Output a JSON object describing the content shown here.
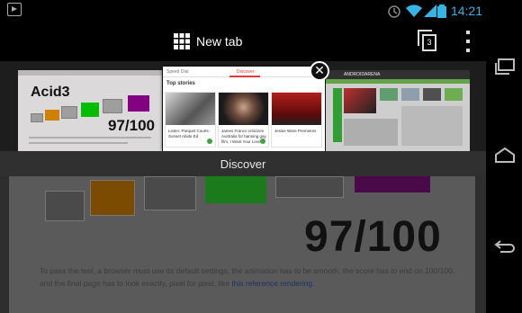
{
  "status_bar": {
    "time": "14:21",
    "icons": [
      "app-notification-icon",
      "alarm-icon",
      "wifi-icon",
      "signal-icon",
      "battery-icon"
    ]
  },
  "action_bar": {
    "new_tab_label": "New tab",
    "tab_count": "3"
  },
  "tabs": {
    "current_title": "Discover",
    "acid3": {
      "title": "Acid3",
      "score": "97/100"
    },
    "discover": {
      "tab_left": "Speed Dial",
      "tab_right": "Discover",
      "section": "Top stories",
      "cards": [
        {
          "caption": "Listen: Parquet Courts - Sunset Abide Ed"
        },
        {
          "caption": "James Franco criticizes Australia for banning gay film, I Want Your Love"
        },
        {
          "caption": "Jessie Ware Premieres"
        }
      ]
    },
    "android": {
      "site": "ANDROIDARENA"
    }
  },
  "background_page": {
    "score": "97/100",
    "description": "To pass the test, a browser must use its default settings, the animation has to be smooth, the score has to end on 100/100, and the final page has to look exactly, pixel for pixel, like",
    "link": "this reference rendering",
    "trailing": "."
  },
  "colors": {
    "accent_time": "#33b5e5",
    "discover_red": "#e53935",
    "orange": "#e08a00",
    "green": "#00cc00",
    "purple": "#8b008b"
  },
  "navigation": [
    "recent-apps-icon",
    "home-icon",
    "back-icon"
  ]
}
